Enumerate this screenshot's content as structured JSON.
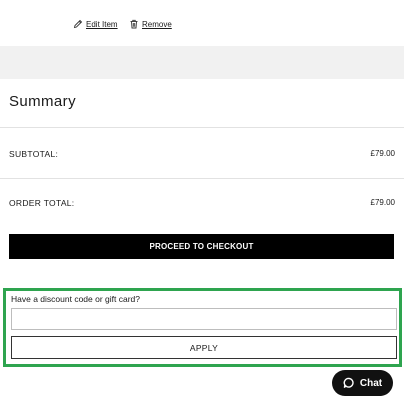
{
  "item_actions": {
    "edit_label": "Edit Item",
    "remove_label": "Remove"
  },
  "summary": {
    "title": "Summary",
    "subtotal_label": "SUBTOTAL:",
    "subtotal_value": "£79.00",
    "order_total_label": "ORDER TOTAL:",
    "order_total_value": "£79.00",
    "checkout_label": "PROCEED TO CHECKOUT"
  },
  "discount": {
    "label": "Have a discount code or gift card?",
    "input_value": "",
    "apply_label": "APPLY",
    "highlight_color": "#2ea44f"
  },
  "chat": {
    "label": "Chat"
  },
  "icons": {
    "edit": "pencil-icon",
    "remove": "trash-icon",
    "chat": "chat-bubble-icon"
  }
}
